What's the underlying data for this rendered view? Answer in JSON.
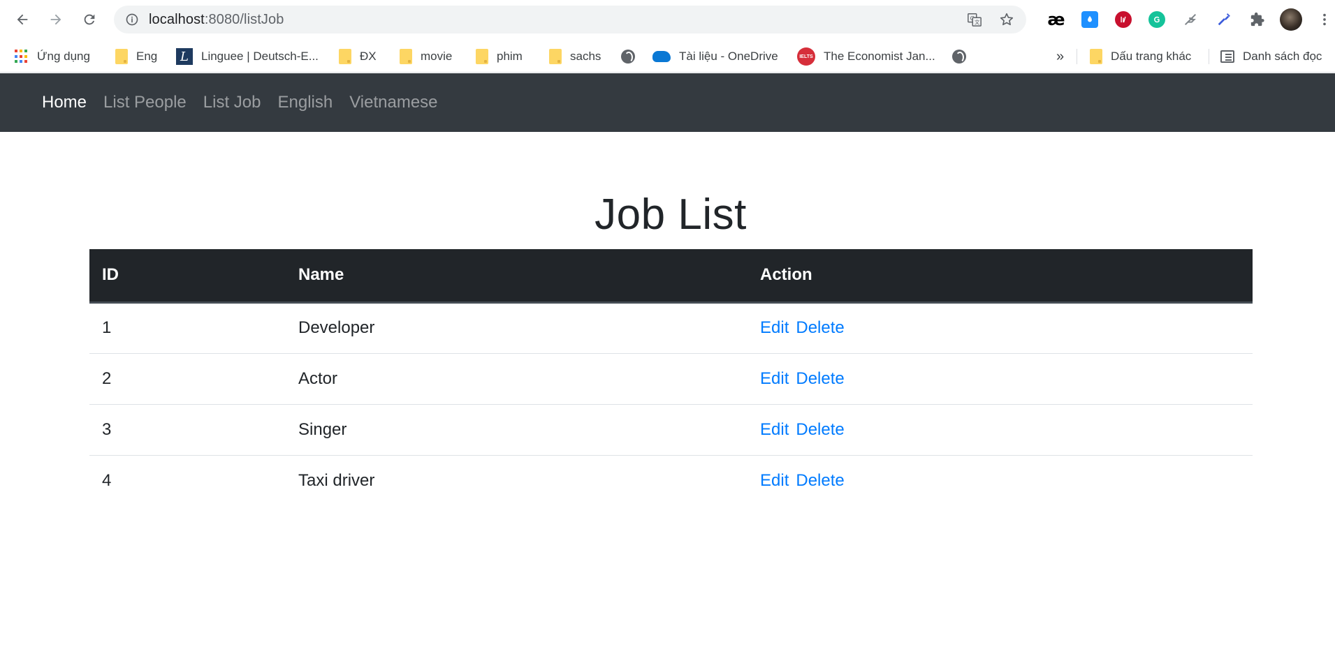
{
  "browser": {
    "url_host": "localhost",
    "url_rest": ":8080/listJob",
    "bookmarks": [
      {
        "label": "Ứng dụng"
      },
      {
        "label": "Eng"
      },
      {
        "label": "Linguee | Deutsch-E..."
      },
      {
        "label": "ĐX"
      },
      {
        "label": "movie"
      },
      {
        "label": "phim"
      },
      {
        "label": "sachs"
      },
      {
        "label": "Tài liệu - OneDrive"
      },
      {
        "label": "The Economist Jan..."
      }
    ],
    "more_bookmarks": "»",
    "other_bookmarks": "Dấu trang khác",
    "reading_list": "Danh sách đọc",
    "ielts_badge": "IELTS",
    "ae_ext": "æ"
  },
  "navbar": {
    "home": "Home",
    "list_people": "List People",
    "list_job": "List Job",
    "english": "English",
    "vietnamese": "Vietnamese"
  },
  "page": {
    "title": "Job List"
  },
  "table": {
    "headers": {
      "id": "ID",
      "name": "Name",
      "action": "Action"
    },
    "rows": [
      {
        "id": "1",
        "name": "Developer"
      },
      {
        "id": "2",
        "name": "Actor"
      },
      {
        "id": "3",
        "name": "Singer"
      },
      {
        "id": "4",
        "name": "Taxi driver"
      }
    ],
    "edit_label": "Edit",
    "delete_label": "Delete"
  }
}
